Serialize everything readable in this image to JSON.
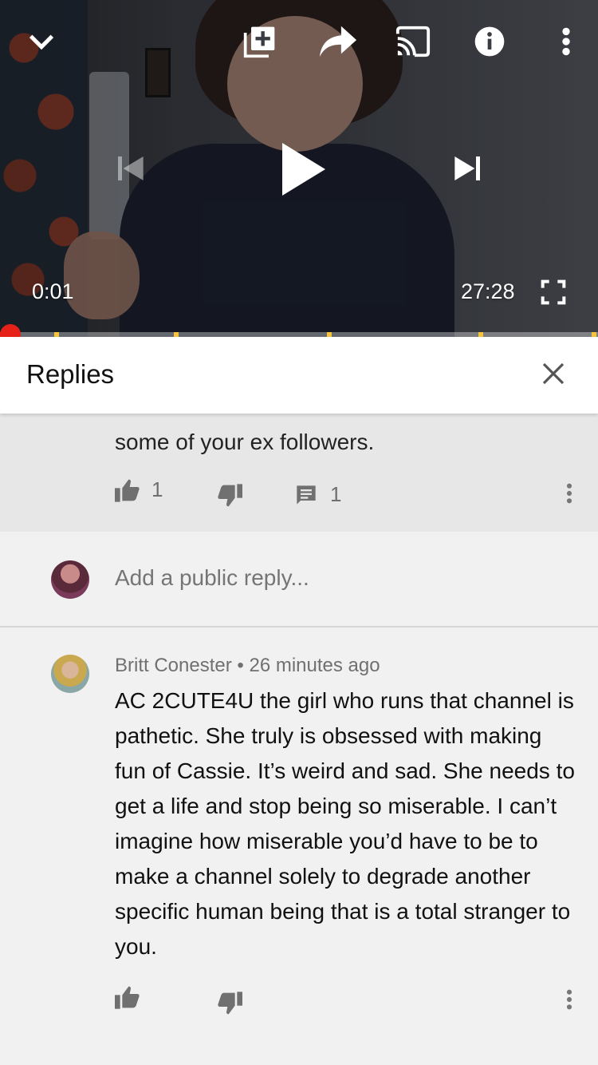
{
  "player": {
    "current_time": "0:01",
    "duration": "27:28",
    "progress_fraction": 0.016,
    "icons": {
      "collapse": "chevron-down-icon",
      "add_to_playlist": "playlist-add-icon",
      "share": "share-icon",
      "cast": "cast-icon",
      "info": "info-icon",
      "more": "more-vert-icon",
      "previous": "skip-previous-icon",
      "play": "play-icon",
      "next": "skip-next-icon",
      "fullscreen": "fullscreen-icon"
    },
    "colors": {
      "progress": "#e62117",
      "ad_marker": "#f6c53d"
    }
  },
  "replies_panel": {
    "title": "Replies",
    "close_icon": "close-icon"
  },
  "parent_comment": {
    "visible_text": "some of your ex followers.",
    "likes": "1",
    "replies": "1"
  },
  "add_reply": {
    "placeholder": "Add a public reply..."
  },
  "reply": {
    "author": "Britt Conester",
    "separator": "•",
    "time": "26 minutes ago",
    "text": "AC 2CUTE4U the girl who runs that channel is pathetic. She truly is obsessed with making fun of Cassie. It’s weird and sad. She needs to get a life and stop being so miserable. I can’t imagine how miserable you’d have to be to make a channel solely to degrade another specific human being that is a total stranger to you."
  }
}
